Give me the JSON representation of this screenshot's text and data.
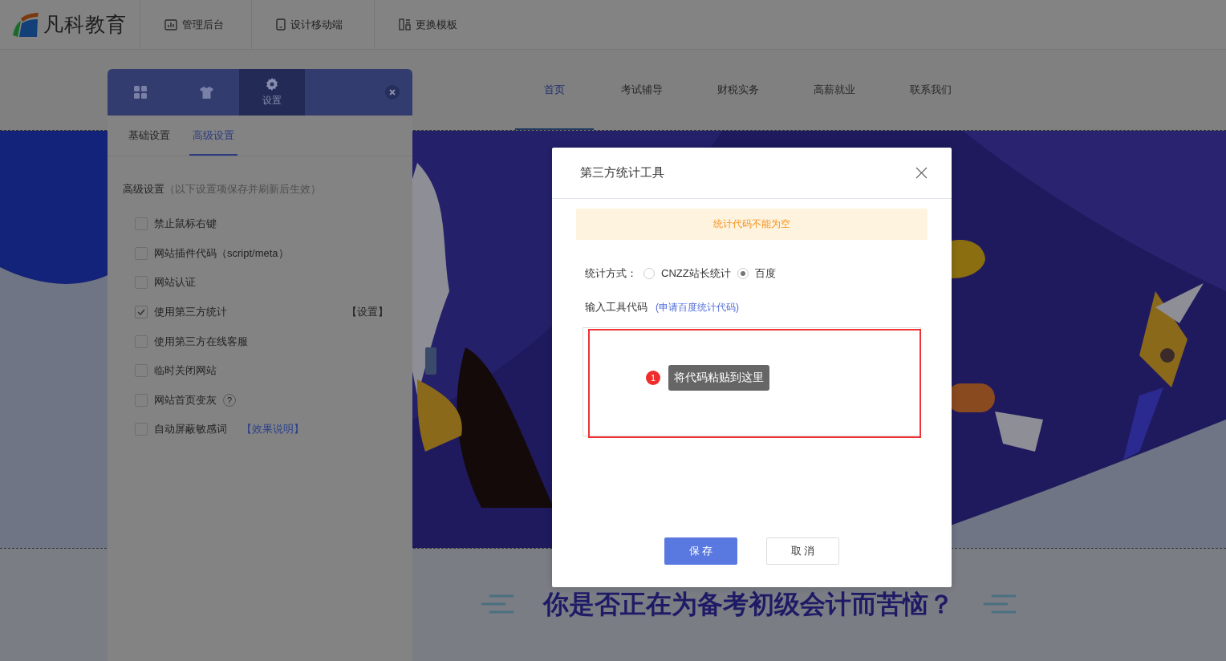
{
  "header": {
    "logo": "凡科教育",
    "buttons": [
      {
        "label": "管理后台",
        "kind": "chart"
      },
      {
        "label": "设计移动端",
        "kind": "phone"
      },
      {
        "label": "更换模板",
        "kind": "layout"
      }
    ]
  },
  "site_nav": [
    {
      "label": "首页",
      "selected": true
    },
    {
      "label": "考试辅导",
      "selected": false
    },
    {
      "label": "财税实务",
      "selected": false
    },
    {
      "label": "高薪就业",
      "selected": false
    },
    {
      "label": "联系我们",
      "selected": false
    }
  ],
  "settings_panel": {
    "tabs": [
      {
        "kind": "grid",
        "selected": false
      },
      {
        "kind": "shirt",
        "selected": false
      },
      {
        "kind": "gear",
        "label": "设置",
        "selected": true
      }
    ],
    "subtabs": [
      {
        "label": "基础设置",
        "selected": false
      },
      {
        "label": "高级设置",
        "selected": true
      }
    ],
    "section_title": "高级设置",
    "section_note": "（以下设置项保存并刷新后生效）",
    "options": [
      {
        "label": "禁止鼠标右键",
        "checked": false
      },
      {
        "label": "网站插件代码（script/meta）",
        "checked": false
      },
      {
        "label": "网站认证",
        "checked": false
      },
      {
        "label": "使用第三方统计",
        "checked": true,
        "action": "【设置】"
      },
      {
        "label": "使用第三方在线客服",
        "checked": false
      },
      {
        "label": "临时关闭网站",
        "checked": false
      },
      {
        "label": "网站首页变灰",
        "checked": false,
        "help": "?"
      },
      {
        "label": "自动屏蔽敏感词",
        "checked": false,
        "link": "【效果说明】"
      }
    ]
  },
  "modal": {
    "title": "第三方统计工具",
    "alert": "统计代码不能为空",
    "method_label": "统计方式：",
    "methods": [
      {
        "label": "CNZZ站长统计",
        "selected": false
      },
      {
        "label": "百度",
        "selected": true
      }
    ],
    "code_label": "输入工具代码",
    "code_link": "(申请百度统计代码)",
    "annotation": {
      "number": "1",
      "text": "将代码粘贴到这里"
    },
    "buttons": [
      {
        "label": "保 存",
        "kind": "primary"
      },
      {
        "label": "取 消",
        "kind": "default"
      }
    ]
  },
  "section_heading": "你是否正在为备考初级会计而苦恼？"
}
